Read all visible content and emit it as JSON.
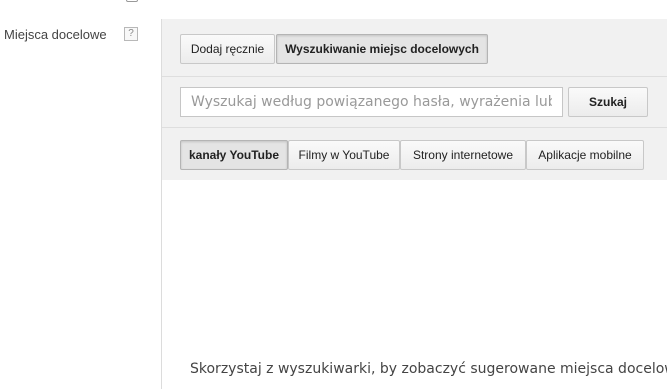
{
  "field": {
    "label": "Miejsca docelowe",
    "help_symbol": "?"
  },
  "tabs": {
    "manual_label": "Dodaj ręcznie",
    "search_label": "Wyszukiwanie miejsc docelowych",
    "active": "search"
  },
  "search": {
    "placeholder": "Wyszukaj według powiązanego hasła, wyrażenia lub ac",
    "button_label": "Szukaj"
  },
  "categories": {
    "items": [
      {
        "label": "kanały YouTube",
        "active": true
      },
      {
        "label": "Filmy w YouTube",
        "active": false
      },
      {
        "label": "Strony internetowe",
        "active": false
      },
      {
        "label": "Aplikacje mobilne",
        "active": false
      }
    ]
  },
  "results": {
    "empty_message": "Skorzystaj z wyszukiwarki, by zobaczyć sugerowane miejsca docelowe"
  }
}
